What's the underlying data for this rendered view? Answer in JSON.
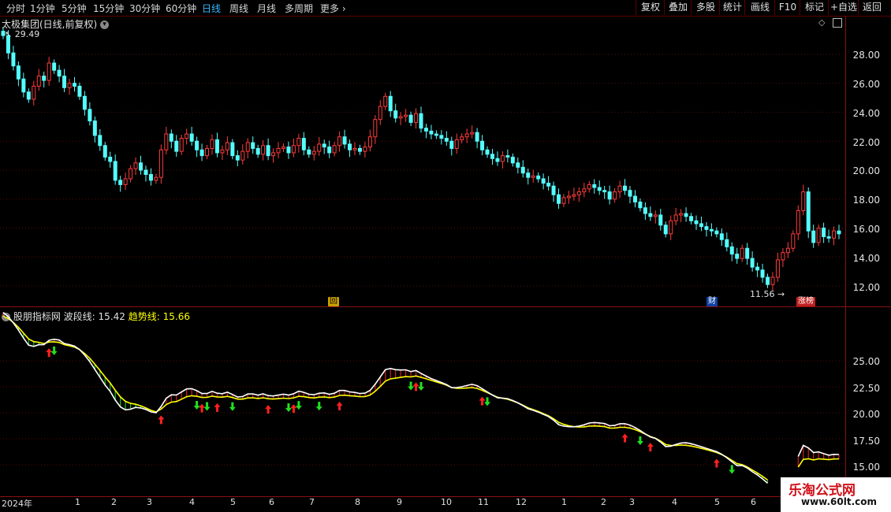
{
  "toolbar": {
    "timeframes": [
      "分时",
      "1分钟",
      "5分钟",
      "15分钟",
      "30分钟",
      "60分钟",
      "日线",
      "周线",
      "月线",
      "多周期",
      "更多"
    ],
    "active_timeframe": "日线",
    "right_buttons": [
      "复权",
      "叠加",
      "多股",
      "统计",
      "画线",
      "F10",
      "标记",
      "+自选",
      "返回"
    ]
  },
  "main_chart": {
    "title": "太极集团(日线,前复权)",
    "high_label": "29.49",
    "low_label": "11.56",
    "y_ticks": [
      "28.00",
      "26.00",
      "24.00",
      "22.00",
      "20.00",
      "18.00",
      "16.00",
      "14.00",
      "12.00"
    ],
    "badges": {
      "hui": "回",
      "cai": "财",
      "zhangbang": "涨榜"
    },
    "up_color": "#ff3c3c",
    "down_color": "#54ffff"
  },
  "indicator": {
    "name": "股朋指标网",
    "line1_label": "波段线:",
    "line1_value": "15.42",
    "line2_label": "趋势线:",
    "line2_value": "15.66",
    "y_ticks": [
      "25.00",
      "22.50",
      "20.00",
      "17.50",
      "15.00"
    ]
  },
  "xaxis": {
    "labels": [
      "2024年",
      "1",
      "2",
      "3",
      "4",
      "5",
      "6",
      "7",
      "8",
      "9",
      "10",
      "11",
      "12",
      "1",
      "2",
      "3",
      "4",
      "5",
      "6"
    ]
  },
  "watermark": {
    "title": "乐淘公式网",
    "url": "www.60lt.com"
  },
  "chart_data": {
    "type": "candlestick",
    "price_range": [
      11.0,
      30.0
    ],
    "indicator_range": [
      14.5,
      28.5
    ],
    "closes": [
      29.3,
      28.1,
      27.2,
      26.3,
      25.4,
      24.9,
      25.8,
      26.5,
      26.2,
      27.4,
      26.9,
      26.5,
      25.7,
      26.0,
      25.8,
      25.1,
      24.2,
      23.4,
      22.4,
      21.7,
      20.9,
      20.6,
      19.3,
      19.0,
      19.4,
      20.1,
      20.5,
      20.0,
      19.7,
      19.3,
      19.5,
      21.4,
      22.5,
      22.0,
      21.3,
      22.2,
      22.5,
      22.0,
      21.4,
      21.0,
      21.5,
      22.1,
      21.2,
      21.4,
      21.9,
      21.0,
      20.7,
      21.3,
      21.9,
      21.5,
      21.1,
      21.7,
      21.0,
      21.2,
      21.5,
      21.6,
      21.2,
      21.7,
      22.2,
      21.4,
      21.1,
      21.3,
      21.8,
      21.6,
      21.2,
      21.7,
      22.3,
      21.8,
      21.4,
      21.5,
      21.3,
      21.6,
      22.3,
      23.5,
      24.4,
      25.1,
      24.1,
      23.6,
      23.7,
      23.8,
      23.3,
      23.9,
      22.9,
      22.7,
      22.5,
      22.4,
      22.2,
      22.0,
      21.5,
      22.1,
      22.3,
      22.5,
      22.6,
      22.0,
      21.4,
      21.1,
      20.8,
      20.6,
      21.0,
      20.9,
      20.5,
      20.2,
      19.8,
      19.5,
      19.6,
      19.4,
      19.1,
      18.9,
      18.3,
      17.7,
      18.1,
      18.2,
      18.3,
      18.5,
      18.7,
      19.0,
      18.8,
      18.6,
      18.5,
      18.0,
      18.5,
      18.9,
      18.6,
      18.2,
      17.8,
      17.4,
      17.0,
      16.8,
      16.9,
      16.2,
      15.6,
      16.5,
      16.9,
      17.0,
      16.8,
      16.5,
      16.3,
      16.1,
      15.9,
      15.8,
      15.6,
      15.2,
      14.7,
      14.2,
      13.9,
      14.6,
      13.9,
      13.3,
      13.1,
      12.6,
      12.1,
      12.6,
      13.8,
      14.3,
      14.6,
      15.6,
      17.2,
      18.5,
      15.8,
      15.0,
      16.0,
      15.4,
      15.3,
      15.8,
      15.6
    ]
  }
}
